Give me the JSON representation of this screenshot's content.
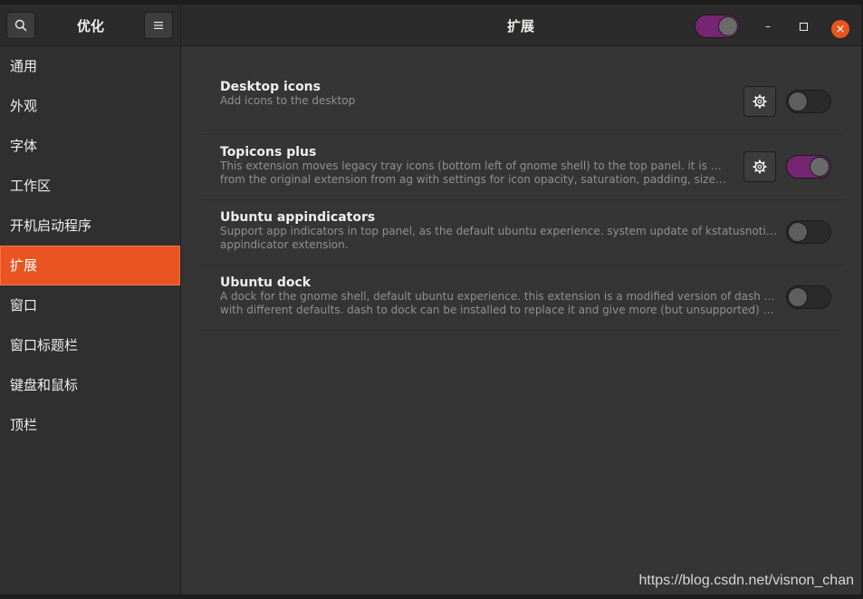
{
  "header": {
    "sidebar_title": "优化",
    "main_title": "扩展",
    "global_switch_on": true,
    "search_icon": "search-icon",
    "menu_icon": "hamburger-menu-icon",
    "minimize_glyph": "–",
    "maximize_glyph": "□",
    "close_glyph": "×"
  },
  "sidebar": {
    "items": [
      {
        "label": "通用"
      },
      {
        "label": "外观"
      },
      {
        "label": "字体"
      },
      {
        "label": "工作区"
      },
      {
        "label": "开机启动程序"
      },
      {
        "label": "扩展",
        "selected": true
      },
      {
        "label": "窗口"
      },
      {
        "label": "窗口标题栏"
      },
      {
        "label": "键盘和鼠标"
      },
      {
        "label": "顶栏"
      }
    ]
  },
  "extensions": [
    {
      "title": "Desktop icons",
      "desc1": "Add icons to the desktop",
      "desc2": "",
      "has_settings": true,
      "enabled": false
    },
    {
      "title": "Topicons plus",
      "desc1": "This extension moves legacy tray icons (bottom left of gnome shell) to the top panel. it is a fork",
      "desc2": "from the original extension from ag  with settings for icon opacity, saturation, padding, size and tr…",
      "has_settings": true,
      "enabled": true
    },
    {
      "title": "Ubuntu appindicators",
      "desc1": "Support app indicators in top panel, as the default ubuntu experience. system update of kstatusnotifieritem/-",
      "desc2": "appindicator extension.",
      "has_settings": false,
      "enabled": false
    },
    {
      "title": "Ubuntu dock",
      "desc1": "A dock for the gnome shell, default ubuntu experience. this extension is a modified version of dash to dock",
      "desc2": "with different defaults. dash to dock can be installed to replace it and give more (but unsupported) configu…",
      "has_settings": false,
      "enabled": false
    }
  ],
  "watermark": "https://blog.csdn.net/visnon_chan",
  "colors": {
    "accent": "#e95420",
    "switch_on": "#762572",
    "background": "#353535",
    "sidebar": "#2f2f2f"
  }
}
